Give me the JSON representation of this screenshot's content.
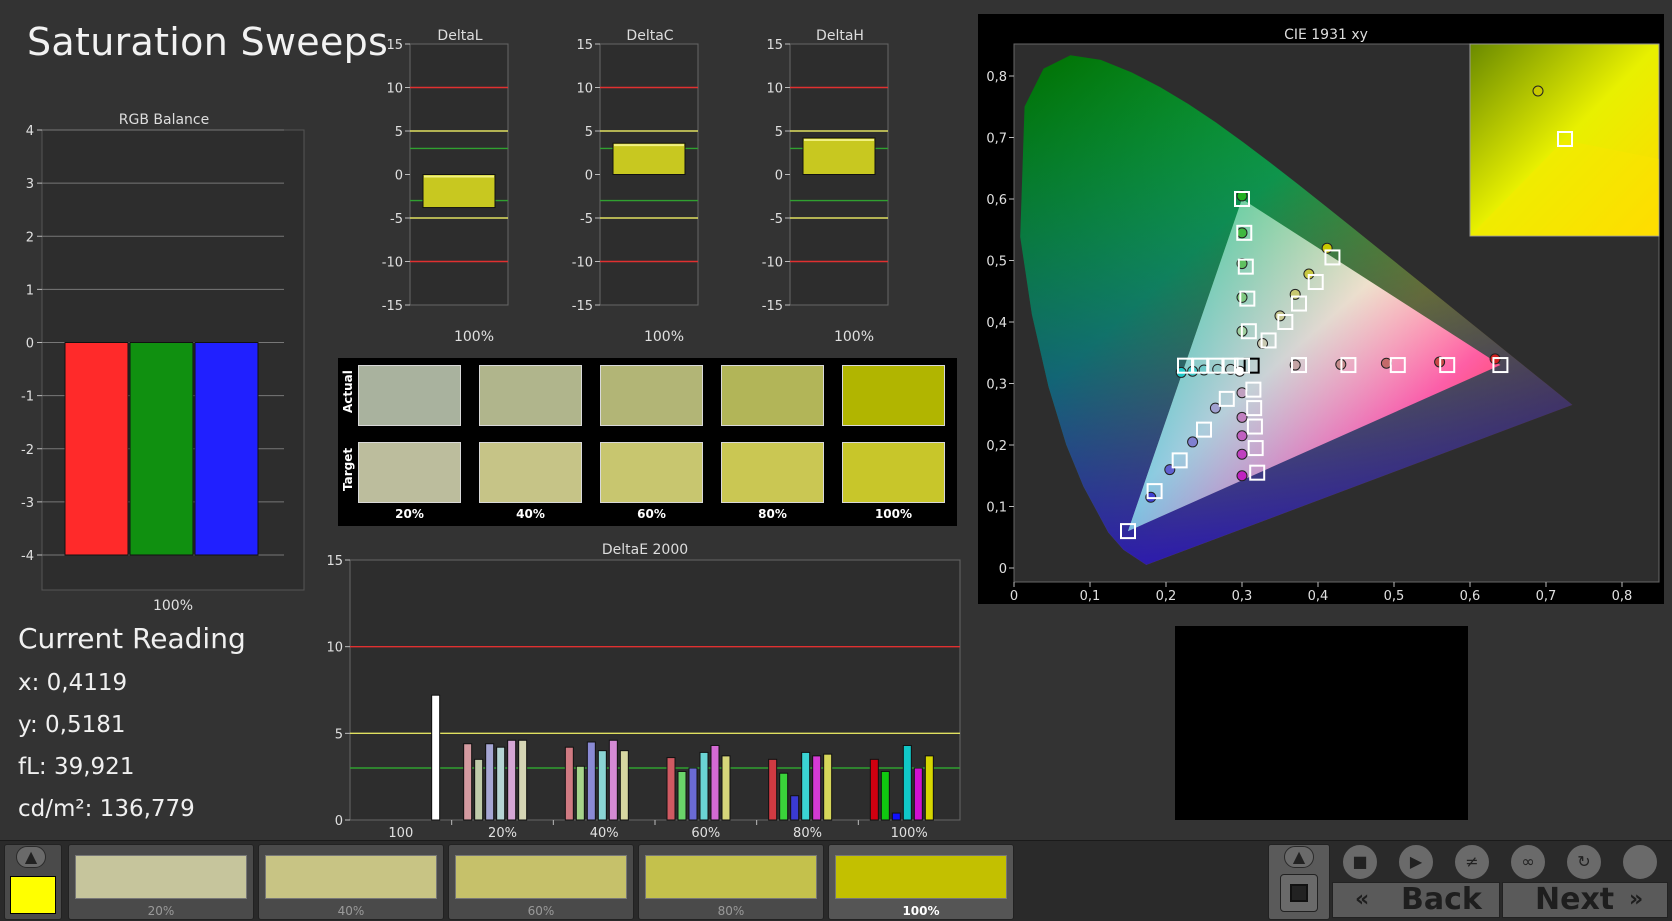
{
  "page": {
    "title": "Saturation Sweeps"
  },
  "rgb_balance": {
    "title": "RGB Balance",
    "x_label": "100%"
  },
  "delta_charts": [
    {
      "title": "DeltaL",
      "x_label": "100%"
    },
    {
      "title": "DeltaC",
      "x_label": "100%"
    },
    {
      "title": "DeltaH",
      "x_label": "100%"
    }
  ],
  "swatches": {
    "row_labels": [
      "Actual",
      "Target"
    ],
    "labels": [
      "20%",
      "40%",
      "60%",
      "80%",
      "100%"
    ],
    "actual_colors": [
      "#a9b29e",
      "#b0b58c",
      "#b2b576",
      "#b2b558",
      "#b1b500"
    ],
    "target_colors": [
      "#bcbd9d",
      "#c6c487",
      "#c8c66f",
      "#cac753",
      "#c8c62a"
    ]
  },
  "deltae": {
    "title": "DeltaE 2000"
  },
  "cie": {
    "title": "CIE 1931 xy"
  },
  "current_reading": {
    "title": "Current Reading",
    "x": "x: 0,4119",
    "y": "y: 0,5181",
    "fl": "fL: 39,921",
    "cdm2": "cd/m²: 136,779"
  },
  "bottom_bar": {
    "current_color": "#ffff00",
    "patches": [
      {
        "label": "20%",
        "color": "#c6c59c"
      },
      {
        "label": "40%",
        "color": "#c8c484"
      },
      {
        "label": "60%",
        "color": "#c6c16a"
      },
      {
        "label": "80%",
        "color": "#c4c14c"
      },
      {
        "label": "100%",
        "color": "#c3c000"
      }
    ],
    "back_label": "Back",
    "next_label": "Next"
  },
  "chart_data": [
    {
      "type": "bar",
      "title": "RGB Balance",
      "categories": [
        "100%"
      ],
      "series": [
        {
          "color": "#ff2a2a",
          "values": [
            -4
          ]
        },
        {
          "color": "#109010",
          "values": [
            -4
          ]
        },
        {
          "color": "#2020ff",
          "values": [
            -4
          ]
        }
      ],
      "ylim": [
        -4,
        4
      ],
      "yticks": [
        "4",
        "3",
        "2",
        "1",
        "0",
        "-1",
        "-2",
        "-3",
        "-4"
      ]
    },
    {
      "type": "bar",
      "title": "DeltaL",
      "categories": [
        "100%"
      ],
      "values": [
        -3.8
      ],
      "ylim": [
        -15,
        15
      ],
      "yticks": [
        "15",
        "10",
        "5",
        "0",
        "-5",
        "-10",
        "-15"
      ],
      "reference_lines": [
        10,
        5,
        3,
        -3,
        -5,
        -10
      ]
    },
    {
      "type": "bar",
      "title": "DeltaC",
      "categories": [
        "100%"
      ],
      "values": [
        3.6
      ],
      "ylim": [
        -15,
        15
      ],
      "yticks": [
        "15",
        "10",
        "5",
        "0",
        "-5",
        "-10",
        "-15"
      ],
      "reference_lines": [
        10,
        5,
        3,
        -3,
        -5,
        -10
      ]
    },
    {
      "type": "bar",
      "title": "DeltaH",
      "categories": [
        "100%"
      ],
      "values": [
        4.2
      ],
      "ylim": [
        -15,
        15
      ],
      "yticks": [
        "15",
        "10",
        "5",
        "0",
        "-5",
        "-10",
        "-15"
      ],
      "reference_lines": [
        10,
        5,
        3,
        -3,
        -5,
        -10
      ]
    },
    {
      "type": "bar",
      "title": "DeltaE 2000",
      "categories": [
        "100",
        "20%",
        "40%",
        "60%",
        "80%",
        "100%"
      ],
      "yticks": [
        "15",
        "10",
        "5",
        "0"
      ],
      "ylim": [
        0,
        15
      ],
      "reference_lines": [
        10,
        5,
        3
      ],
      "groups": [
        {
          "bars": [
            {
              "value": 7.2,
              "color": "#ffffff"
            }
          ]
        },
        {
          "bars": [
            {
              "value": 4.4,
              "color": "#d49aa0"
            },
            {
              "value": 3.5,
              "color": "#bfcbaa"
            },
            {
              "value": 4.4,
              "color": "#a6a6d4"
            },
            {
              "value": 4.2,
              "color": "#b5d4d4"
            },
            {
              "value": 4.6,
              "color": "#d4a6d4"
            },
            {
              "value": 4.6,
              "color": "#d6d6b5"
            }
          ]
        },
        {
          "bars": [
            {
              "value": 4.2,
              "color": "#d07a82"
            },
            {
              "value": 3.1,
              "color": "#a6d48a"
            },
            {
              "value": 4.5,
              "color": "#8a8ad4"
            },
            {
              "value": 4.0,
              "color": "#8ad4d4"
            },
            {
              "value": 4.6,
              "color": "#d48ad4"
            },
            {
              "value": 4.0,
              "color": "#d6d6a0"
            }
          ]
        },
        {
          "bars": [
            {
              "value": 3.6,
              "color": "#d05a62"
            },
            {
              "value": 2.8,
              "color": "#6ad46a"
            },
            {
              "value": 3.0,
              "color": "#6a6ad4"
            },
            {
              "value": 3.9,
              "color": "#6ad4d4"
            },
            {
              "value": 4.3,
              "color": "#d46ad4"
            },
            {
              "value": 3.7,
              "color": "#d6d67a"
            }
          ]
        },
        {
          "bars": [
            {
              "value": 3.5,
              "color": "#d03a42"
            },
            {
              "value": 2.7,
              "color": "#3ad43a"
            },
            {
              "value": 1.4,
              "color": "#3a3ad4"
            },
            {
              "value": 3.9,
              "color": "#3ad4d4"
            },
            {
              "value": 3.7,
              "color": "#d43ad4"
            },
            {
              "value": 3.8,
              "color": "#d6d65a"
            }
          ]
        },
        {
          "bars": [
            {
              "value": 3.5,
              "color": "#d00010"
            },
            {
              "value": 2.8,
              "color": "#10c810"
            },
            {
              "value": 0.4,
              "color": "#1010ff"
            },
            {
              "value": 4.3,
              "color": "#10c8c8"
            },
            {
              "value": 3.0,
              "color": "#d010d0"
            },
            {
              "value": 3.7,
              "color": "#d6d600"
            }
          ]
        }
      ]
    },
    {
      "type": "scatter",
      "title": "CIE 1931 xy",
      "xlim": [
        0,
        0.8
      ],
      "ylim": [
        0,
        0.8
      ],
      "xticks": [
        "0",
        "0,1",
        "0,2",
        "0,3",
        "0,4",
        "0,5",
        "0,6",
        "0,7",
        "0,8"
      ],
      "yticks": [
        "0",
        "0,1",
        "0,2",
        "0,3",
        "0,4",
        "0,5",
        "0,6",
        "0,7",
        "0,8"
      ],
      "gamut_triangle": [
        [
          0.64,
          0.33
        ],
        [
          0.3,
          0.6
        ],
        [
          0.15,
          0.06
        ]
      ],
      "targets": [
        [
          0.3127,
          0.329
        ],
        [
          0.64,
          0.33
        ],
        [
          0.57,
          0.33
        ],
        [
          0.505,
          0.33
        ],
        [
          0.44,
          0.33
        ],
        [
          0.375,
          0.33
        ],
        [
          0.3,
          0.6
        ],
        [
          0.303,
          0.545
        ],
        [
          0.305,
          0.49
        ],
        [
          0.307,
          0.438
        ],
        [
          0.309,
          0.385
        ],
        [
          0.15,
          0.06
        ],
        [
          0.185,
          0.125
        ],
        [
          0.218,
          0.175
        ],
        [
          0.25,
          0.225
        ],
        [
          0.28,
          0.275
        ],
        [
          0.32,
          0.155
        ],
        [
          0.318,
          0.195
        ],
        [
          0.317,
          0.23
        ],
        [
          0.316,
          0.26
        ],
        [
          0.315,
          0.29
        ],
        [
          0.419,
          0.505
        ],
        [
          0.397,
          0.465
        ],
        [
          0.375,
          0.43
        ],
        [
          0.357,
          0.4
        ],
        [
          0.335,
          0.37
        ],
        [
          0.225,
          0.329
        ],
        [
          0.245,
          0.329
        ],
        [
          0.265,
          0.329
        ],
        [
          0.285,
          0.329
        ],
        [
          0.3,
          0.329
        ]
      ],
      "measured": [
        {
          "x": 0.633,
          "y": 0.34,
          "color": "#d02020"
        },
        {
          "x": 0.56,
          "y": 0.335,
          "color": "#c84848"
        },
        {
          "x": 0.49,
          "y": 0.333,
          "color": "#c46a6a"
        },
        {
          "x": 0.43,
          "y": 0.331,
          "color": "#c48a8a"
        },
        {
          "x": 0.37,
          "y": 0.33,
          "color": "#c4a4a4"
        },
        {
          "x": 0.3,
          "y": 0.605,
          "color": "#20b020"
        },
        {
          "x": 0.3,
          "y": 0.545,
          "color": "#40b840"
        },
        {
          "x": 0.3,
          "y": 0.495,
          "color": "#60c060"
        },
        {
          "x": 0.3,
          "y": 0.44,
          "color": "#80c880"
        },
        {
          "x": 0.3,
          "y": 0.385,
          "color": "#a0d0a0"
        },
        {
          "x": 0.18,
          "y": 0.115,
          "color": "#4040d0"
        },
        {
          "x": 0.205,
          "y": 0.16,
          "color": "#6060d0"
        },
        {
          "x": 0.235,
          "y": 0.205,
          "color": "#8080d0"
        },
        {
          "x": 0.265,
          "y": 0.26,
          "color": "#a0a0d0"
        },
        {
          "x": 0.3,
          "y": 0.15,
          "color": "#c020c0"
        },
        {
          "x": 0.3,
          "y": 0.185,
          "color": "#c040c0"
        },
        {
          "x": 0.3,
          "y": 0.215,
          "color": "#c060c0"
        },
        {
          "x": 0.3,
          "y": 0.245,
          "color": "#c080c0"
        },
        {
          "x": 0.3,
          "y": 0.285,
          "color": "#c0a0c0"
        },
        {
          "x": 0.412,
          "y": 0.52,
          "color": "#c8c800"
        },
        {
          "x": 0.388,
          "y": 0.478,
          "color": "#c8c840"
        },
        {
          "x": 0.37,
          "y": 0.445,
          "color": "#c8c870"
        },
        {
          "x": 0.35,
          "y": 0.41,
          "color": "#c8c890"
        },
        {
          "x": 0.327,
          "y": 0.365,
          "color": "#c8c8b0"
        },
        {
          "x": 0.22,
          "y": 0.318,
          "color": "#20c8c8"
        },
        {
          "x": 0.235,
          "y": 0.32,
          "color": "#40c8c8"
        },
        {
          "x": 0.25,
          "y": 0.322,
          "color": "#70c8c8"
        },
        {
          "x": 0.268,
          "y": 0.323,
          "color": "#90c8c8"
        },
        {
          "x": 0.285,
          "y": 0.323,
          "color": "#b0c8c8"
        },
        {
          "x": 0.297,
          "y": 0.32,
          "color": "#ffffff"
        }
      ]
    }
  ]
}
